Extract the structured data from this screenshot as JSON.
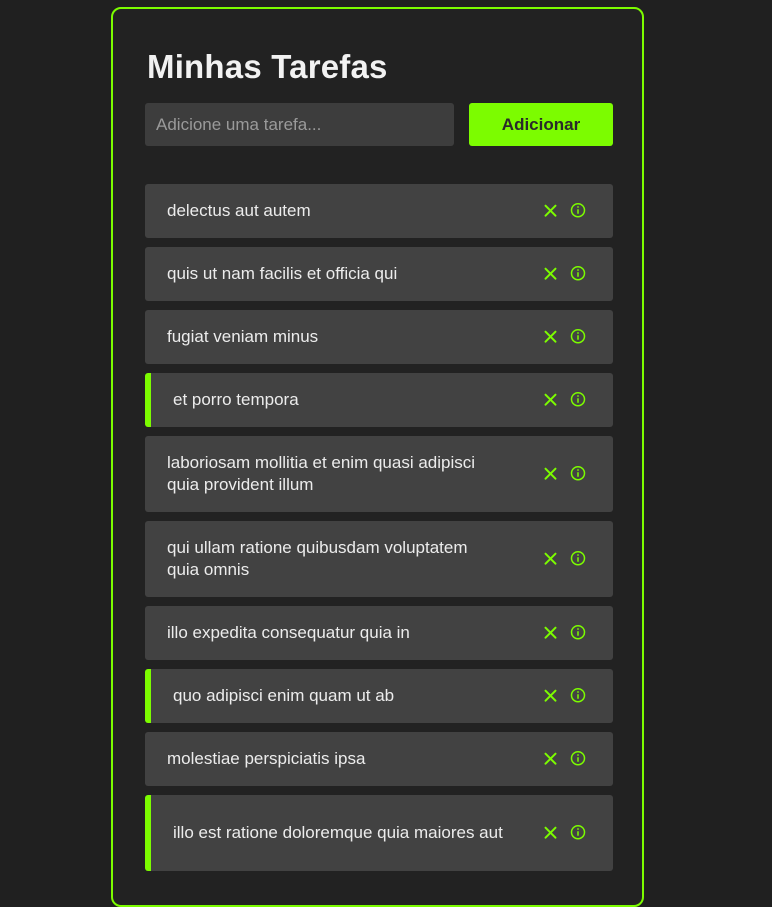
{
  "app": {
    "title": "Minhas Tarefas"
  },
  "form": {
    "input_placeholder": "Adicione uma tarefa...",
    "input_value": "",
    "add_label": "Adicionar"
  },
  "colors": {
    "accent": "#7cfc00",
    "background": "#202020",
    "panel": "#222222",
    "item": "#424242"
  },
  "tasks": [
    {
      "text": "delectus aut autem",
      "completed": false
    },
    {
      "text": "quis ut nam facilis et officia qui",
      "completed": false
    },
    {
      "text": "fugiat veniam minus",
      "completed": false
    },
    {
      "text": "et porro tempora",
      "completed": true
    },
    {
      "text": "laboriosam mollitia et enim quasi adipisci quia provident illum",
      "completed": false
    },
    {
      "text": "qui ullam ratione quibusdam voluptatem quia omnis",
      "completed": false
    },
    {
      "text": "illo expedita consequatur quia in",
      "completed": false
    },
    {
      "text": "quo adipisci enim quam ut ab",
      "completed": true
    },
    {
      "text": "molestiae perspiciatis ipsa",
      "completed": false
    },
    {
      "text": "illo est ratione doloremque quia maiores aut",
      "completed": true
    }
  ],
  "icons": {
    "remove": "close-icon",
    "info": "info-icon"
  }
}
